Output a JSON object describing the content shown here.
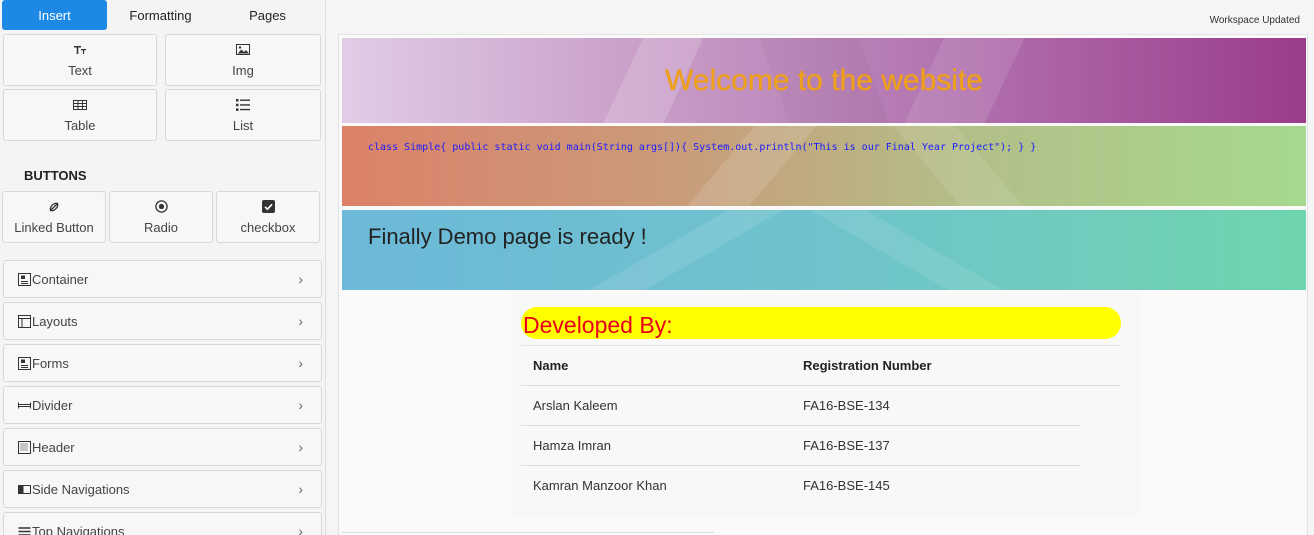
{
  "sidebar": {
    "tabs": [
      {
        "label": "Insert",
        "active": true
      },
      {
        "label": "Formatting",
        "active": false
      },
      {
        "label": "Pages",
        "active": false
      }
    ],
    "basic": [
      {
        "label": "Text",
        "icon": "text-format-icon"
      },
      {
        "label": "Img",
        "icon": "image-icon"
      },
      {
        "label": "Table",
        "icon": "table-icon"
      },
      {
        "label": "List",
        "icon": "list-icon"
      }
    ],
    "buttons_title": "BUTTONS",
    "buttons": [
      {
        "label": "Linked Button",
        "icon": "link-icon"
      },
      {
        "label": "Radio",
        "icon": "radio-icon"
      },
      {
        "label": "checkbox",
        "icon": "checkbox-icon"
      }
    ],
    "accordions": [
      {
        "label": "Container",
        "icon": "container-icon"
      },
      {
        "label": "Layouts",
        "icon": "layout-icon"
      },
      {
        "label": "Forms",
        "icon": "form-icon"
      },
      {
        "label": "Divider",
        "icon": "divider-icon"
      },
      {
        "label": "Header",
        "icon": "header-icon"
      },
      {
        "label": "Side Navigations",
        "icon": "side-nav-icon"
      },
      {
        "label": "Top Navigations",
        "icon": "top-nav-icon"
      }
    ]
  },
  "main": {
    "status": "Workspace Updated",
    "banner1_title": "Welcome to the website",
    "banner2_code": "class Simple{ public static void main(String args[]){ System.out.println(\"This is our Final Year Project\"); } }",
    "banner3_text": "Finally Demo page is ready !",
    "developed_by": "Developed By:",
    "table": {
      "headers": [
        "Name",
        "Registration Number"
      ],
      "rows": [
        [
          "Arslan Kaleem",
          "FA16-BSE-134"
        ],
        [
          "Hamza Imran",
          "FA16-BSE-137"
        ],
        [
          "Kamran Manzoor Khan",
          "FA16-BSE-145"
        ]
      ]
    }
  },
  "colors": {
    "accent": "#1e88e5",
    "welcome_text": "#f0a11a",
    "code_text": "#1a1aff",
    "developed_bg": "#ffff00",
    "developed_text": "#e8001c"
  }
}
